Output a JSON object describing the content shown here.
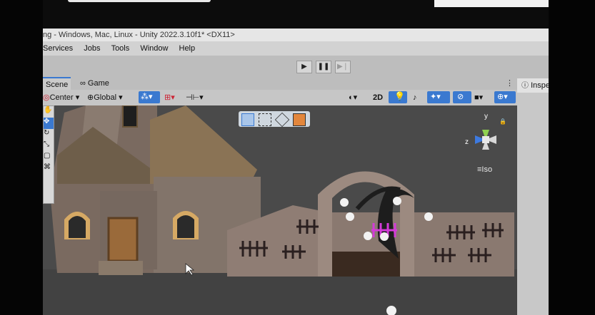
{
  "window": {
    "title": "ng - Windows, Mac, Linux - Unity 2022.3.10f1* <DX11>"
  },
  "menu": {
    "items": [
      "Services",
      "Jobs",
      "Tools",
      "Window",
      "Help"
    ]
  },
  "tabs": {
    "scene": "Scene",
    "game": "Game",
    "inspector": "Inspe"
  },
  "toolbar": {
    "pivot_label": "Center",
    "space_label": "Global",
    "mode_2d": "2D"
  },
  "gizmo": {
    "y_label": "y",
    "z_label": "z",
    "projection_label": "Iso"
  },
  "playback": {
    "play": "▶",
    "pause": "❚❚",
    "step": "▶❘"
  },
  "icons": [
    "play-icon",
    "pause-icon",
    "step-icon",
    "hand-tool-icon",
    "move-tool-icon",
    "rotate-tool-icon",
    "rect-tool-icon",
    "lighting-icon",
    "audio-icon",
    "effects-icon",
    "camera-icon",
    "gizmos-icon",
    "lock-icon",
    "menu-icon"
  ],
  "colors": {
    "selection_blue": "#3a79d0",
    "toolbar_bg": "#c6c6c6",
    "viewport_bg": "#4a4a4a",
    "highlight_magenta": "#d43ad9"
  }
}
